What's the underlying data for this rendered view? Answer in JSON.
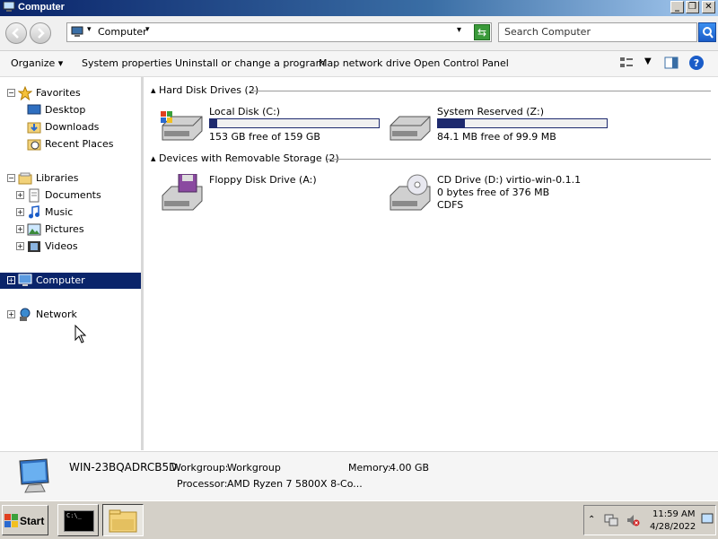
{
  "window": {
    "title": "Computer",
    "minimize": "_",
    "restore": "❐",
    "close": "✕"
  },
  "address": {
    "breadcrumb": "Computer",
    "search_placeholder": "Search Computer"
  },
  "toolbar": {
    "organize": "Organize",
    "system_properties": "System properties",
    "uninstall": "Uninstall or change a program",
    "map_drive": "Map network drive",
    "control_panel": "Open Control Panel"
  },
  "nav": {
    "favorites": "Favorites",
    "desktop": "Desktop",
    "downloads": "Downloads",
    "recent": "Recent Places",
    "libraries": "Libraries",
    "documents": "Documents",
    "music": "Music",
    "pictures": "Pictures",
    "videos": "Videos",
    "computer": "Computer",
    "network": "Network"
  },
  "groups": {
    "hdd": "Hard Disk Drives (2)",
    "removable": "Devices with Removable Storage (2)"
  },
  "drives": {
    "c": {
      "name": "Local Disk (C:)",
      "free": "153 GB free of 159 GB",
      "used_fraction": 0.04
    },
    "z": {
      "name": "System Reserved (Z:)",
      "free": "84.1 MB free of 99.9 MB",
      "used_fraction": 0.16
    },
    "a": {
      "name": "Floppy Disk Drive (A:)"
    },
    "d": {
      "name": "CD Drive (D:) virtio-win-0.1.1",
      "free": "0 bytes free of 376 MB",
      "fs": "CDFS"
    }
  },
  "details": {
    "computer_name": "WIN-23BQADRCB5D",
    "workgroup_label": "Workgroup:",
    "workgroup": "Workgroup",
    "memory_label": "Memory:",
    "memory": "4.00 GB",
    "processor_label": "Processor:",
    "processor": "AMD Ryzen 7 5800X 8-Co..."
  },
  "taskbar": {
    "start": "Start",
    "cmd_text": "C:\\_",
    "time": "11:59 AM",
    "date": "4/28/2022"
  }
}
